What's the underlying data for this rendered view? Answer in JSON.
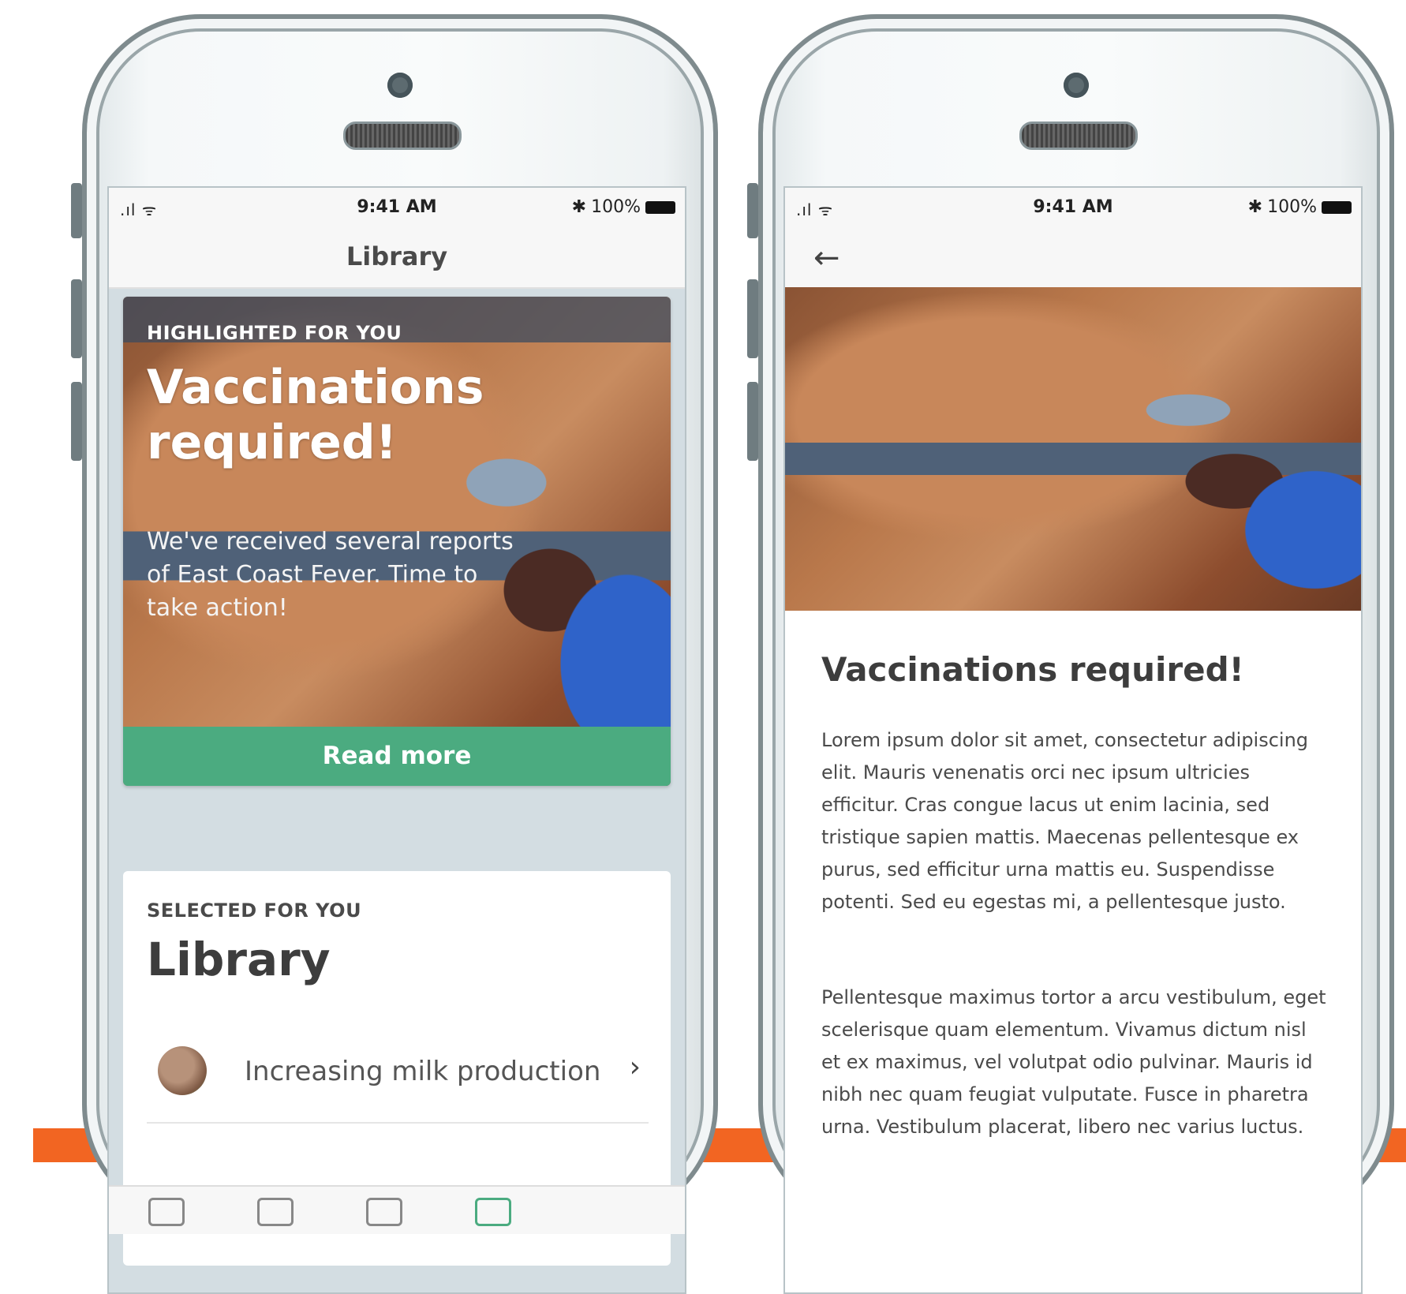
{
  "status_bar": {
    "time": "9:41 AM",
    "battery": "100%",
    "signal": ".ıl ᯤ"
  },
  "library_screen": {
    "nav_title": "Library",
    "hero": {
      "eyebrow": "HIGHLIGHTED FOR YOU",
      "title": "Vaccinations required!",
      "body": "We've received several reports of East Coast Fever. Time to take action!",
      "button_label": "Read more"
    },
    "selected": {
      "eyebrow": "SELECTED FOR YOU",
      "title": "Library",
      "items": [
        {
          "label": "Increasing milk production"
        }
      ]
    }
  },
  "article_screen": {
    "back_icon": "arrow-left-icon",
    "title": "Vaccinations required!",
    "paragraphs": [
      "Lorem ipsum dolor sit amet, consectetur adipiscing elit. Mauris venenatis orci nec ipsum ultricies efficitur. Cras congue lacus ut enim lacinia, sed tristique sapien mattis. Maecenas pellentesque ex purus, sed efficitur urna mattis eu. Suspendisse potenti. Sed eu egestas mi, a pellentesque justo.",
      "Pellentesque maximus tortor a arcu vestibulum, eget scelerisque quam elementum. Vivamus dictum nisl et ex maximus, vel volutpat odio pulvinar. Mauris id nibh nec quam feugiat vulputate. Fusce in pharetra urna. Vestibulum placerat, libero nec varius luctus."
    ]
  },
  "colors": {
    "accent": "#4bab80",
    "brand_band": "#f26522"
  }
}
